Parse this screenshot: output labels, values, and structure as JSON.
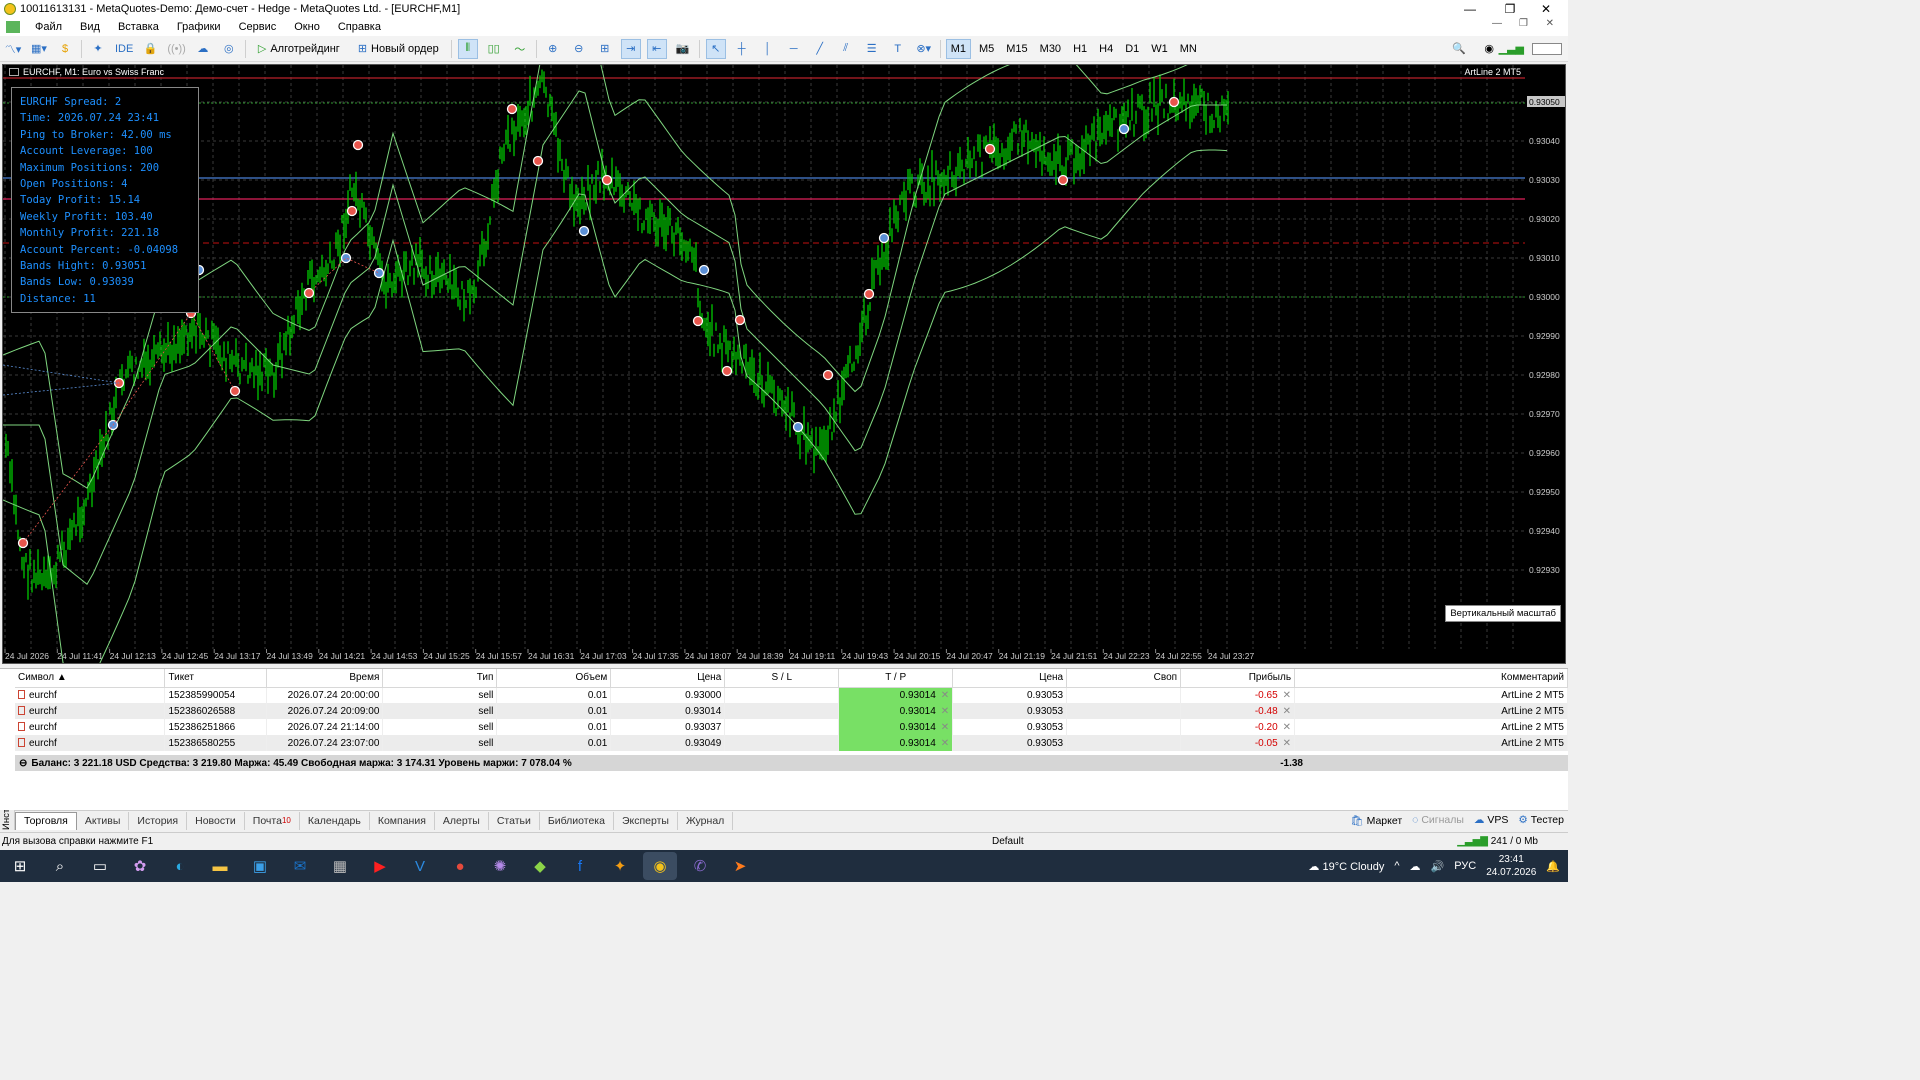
{
  "window": {
    "title": "10011613131 - MetaQuotes-Demo: Демо-счет - Hedge - MetaQuotes Ltd. - [EURCHF,M1]",
    "minimize": "—",
    "restore": "❐",
    "close": "✕"
  },
  "menu": [
    "Файл",
    "Вид",
    "Вставка",
    "Графики",
    "Сервис",
    "Окно",
    "Справка"
  ],
  "toolbar": {
    "algo": "Алготрейдинг",
    "new_order": "Новый ордер",
    "ide": "IDE",
    "timeframes": [
      "M1",
      "M5",
      "M15",
      "M30",
      "H1",
      "H4",
      "D1",
      "W1",
      "MN"
    ],
    "active_tf": "M1"
  },
  "chart": {
    "title": "EURCHF, M1:  Euro vs Swiss Franc",
    "ea_label": "ArtLine 2 MT5",
    "price_labels": [
      "0.93050",
      "0.93040",
      "0.93030",
      "0.93020",
      "0.93010",
      "0.93000",
      "0.92990",
      "0.92980",
      "0.92970",
      "0.92960",
      "0.92950",
      "0.92940",
      "0.92930"
    ],
    "current_price": "0.93050",
    "time_labels": [
      "24 Jul 2026",
      "24 Jul 11:41",
      "24 Jul 12:13",
      "24 Jul 12:45",
      "24 Jul 13:17",
      "24 Jul 13:49",
      "24 Jul 14:21",
      "24 Jul 14:53",
      "24 Jul 15:25",
      "24 Jul 15:57",
      "24 Jul 16:31",
      "24 Jul 17:03",
      "24 Jul 17:35",
      "24 Jul 18:07",
      "24 Jul 18:39",
      "24 Jul 19:11",
      "24 Jul 19:43",
      "24 Jul 20:15",
      "24 Jul 20:47",
      "24 Jul 21:19",
      "24 Jul 21:51",
      "24 Jul 22:23",
      "24 Jul 22:55",
      "24 Jul 23:27"
    ],
    "candle_color": "#00c800",
    "band_color": "#7fd67f",
    "vscale_tip": "Вертикальный масштаб"
  },
  "info": {
    "lines": [
      "EURCHF Spread: 2",
      "Time: 2026.07.24 23:41",
      "Ping to Broker: 42.00 ms",
      "Account Leverage: 100",
      "Maximum Positions: 200",
      "Open Positions: 4",
      "Today Profit: 15.14",
      "Weekly Profit: 103.40",
      "Monthly Profit: 221.18",
      "Account Percent: -0.04098",
      "Bands Hight: 0.93051",
      "Bands Low: 0.93039",
      "Distance: 11"
    ]
  },
  "trade": {
    "headers": [
      "Символ",
      "Тикет",
      "Время",
      "Тип",
      "Объем",
      "Цена",
      "S / L",
      "T / P",
      "Цена",
      "Своп",
      "Прибыль",
      "Комментарий"
    ],
    "rows": [
      [
        "eurchf",
        "152385990054",
        "2026.07.24 20:00:00",
        "sell",
        "0.01",
        "0.93000",
        "",
        "0.93014",
        "0.93053",
        "",
        "-0.65",
        "ArtLine 2 MT5"
      ],
      [
        "eurchf",
        "152386026588",
        "2026.07.24 20:09:00",
        "sell",
        "0.01",
        "0.93014",
        "",
        "0.93014",
        "0.93053",
        "",
        "-0.48",
        "ArtLine 2 MT5"
      ],
      [
        "eurchf",
        "152386251866",
        "2026.07.24 21:14:00",
        "sell",
        "0.01",
        "0.93037",
        "",
        "0.93014",
        "0.93053",
        "",
        "-0.20",
        "ArtLine 2 MT5"
      ],
      [
        "eurchf",
        "152386580255",
        "2026.07.24 23:07:00",
        "sell",
        "0.01",
        "0.93049",
        "",
        "0.93014",
        "0.93053",
        "",
        "-0.05",
        "ArtLine 2 MT5"
      ]
    ],
    "balance": "Баланс: 3 221.18 USD  Средства: 3 219.80  Маржа: 45.49  Свободная маржа: 3 174.31  Уровень маржи: 7 078.04 %",
    "total": "-1.38"
  },
  "side_label": "Инструменты",
  "tabs": [
    "Торговля",
    "Активы",
    "История",
    "Новости",
    "Почта",
    "Календарь",
    "Компания",
    "Алерты",
    "Статьи",
    "Библиотека",
    "Эксперты",
    "Журнал"
  ],
  "mail_count": "10",
  "tabs_right": [
    "Маркет",
    "Сигналы",
    "VPS",
    "Тестер"
  ],
  "status": {
    "help": "Для вызова справки нажмите F1",
    "profile": "Default",
    "traffic": "241 / 0 Mb"
  },
  "taskbar": {
    "weather": "19°C  Cloudy",
    "lang": "РУС",
    "time": "23:41",
    "date": "24.07.2026"
  }
}
